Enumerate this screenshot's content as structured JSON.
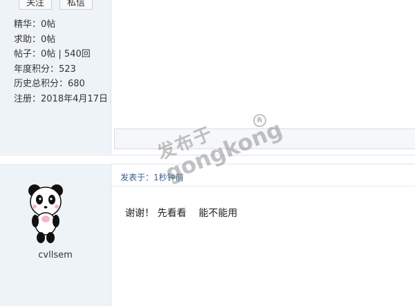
{
  "profile": {
    "follow_label": "关注",
    "message_label": "私信",
    "stats": [
      "精华：0帖",
      "求助：0帖",
      "帖子：0帖 | 540回",
      "年度积分：523",
      "历史总积分：680",
      "注册：2018年4月17日"
    ]
  },
  "post": {
    "username": "cvllsem",
    "meta": "发表于：1秒钟前",
    "body": "谢谢！ 先看看    能不能用"
  },
  "watermark": {
    "cn": "发布于",
    "en": "gongkong",
    "reg": "R"
  }
}
